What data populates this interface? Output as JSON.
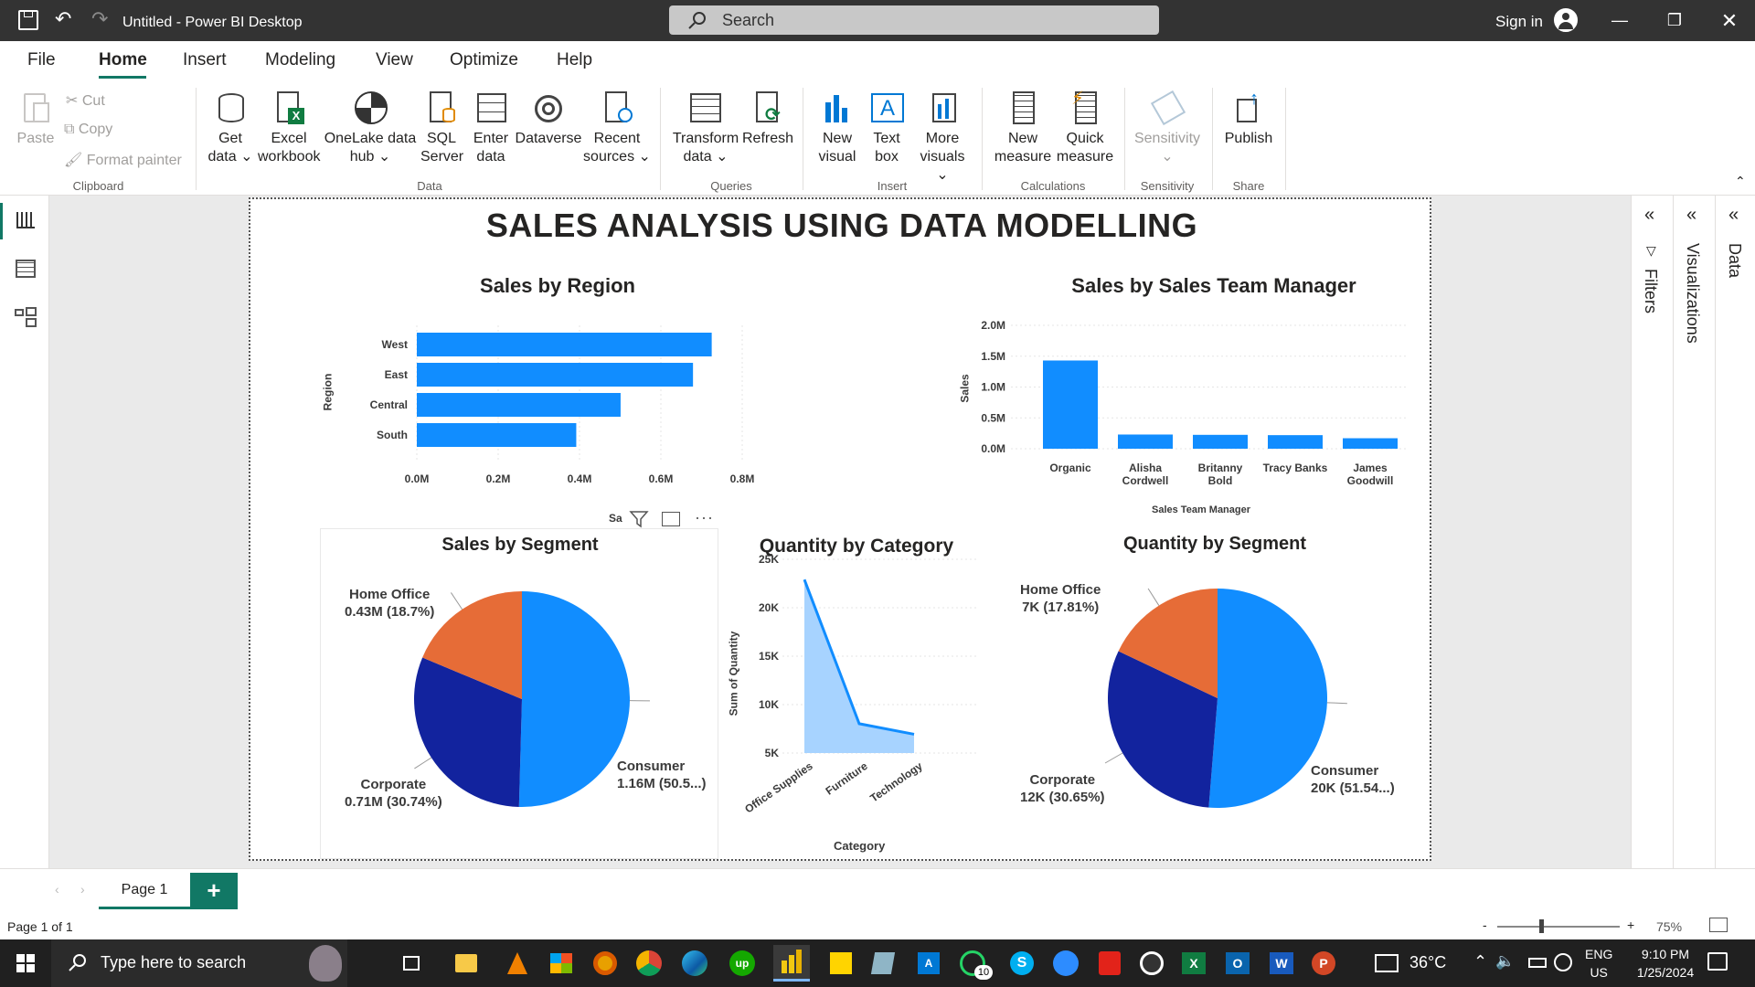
{
  "window": {
    "title": "Untitled - Power BI Desktop",
    "search_placeholder": "Search",
    "sign_in": "Sign in"
  },
  "menu": [
    "File",
    "Home",
    "Insert",
    "Modeling",
    "View",
    "Optimize",
    "Help"
  ],
  "ribbon": {
    "clipboard": {
      "paste": "Paste",
      "cut": "Cut",
      "copy": "Copy",
      "format_painter": "Format painter",
      "group": "Clipboard"
    },
    "data": {
      "get_data": "Get",
      "get_data2": "data",
      "excel": "Excel",
      "excel2": "workbook",
      "onelake": "OneLake data",
      "onelake2": "hub",
      "sql": "SQL",
      "sql2": "Server",
      "enter": "Enter",
      "enter2": "data",
      "dataverse": "Dataverse",
      "recent": "Recent",
      "recent2": "sources",
      "group": "Data"
    },
    "queries": {
      "transform": "Transform",
      "transform2": "data",
      "refresh": "Refresh",
      "group": "Queries"
    },
    "insert": {
      "new_visual": "New",
      "new_visual2": "visual",
      "text_box": "Text",
      "text_box2": "box",
      "more_visuals": "More",
      "more_visuals2": "visuals",
      "group": "Insert"
    },
    "calculations": {
      "new_measure": "New",
      "new_measure2": "measure",
      "quick_measure": "Quick",
      "quick_measure2": "measure",
      "group": "Calculations"
    },
    "sensitivity": {
      "label": "Sensitivity",
      "group": "Sensitivity"
    },
    "share": {
      "publish": "Publish",
      "group": "Share"
    }
  },
  "report_title": "SALES ANALYSIS USING DATA MODELLING",
  "charts": {
    "region": {
      "title": "Sales by Region",
      "ylabel": "Region",
      "xlabel": "Sa",
      "ticks": [
        "0.0M",
        "0.2M",
        "0.4M",
        "0.6M",
        "0.8M"
      ]
    },
    "manager": {
      "title": "Sales by Sales Team Manager",
      "ylabel": "Sales",
      "xlabel": "Sales Team Manager",
      "ticks": [
        "0.0M",
        "0.5M",
        "1.0M",
        "1.5M",
        "2.0M"
      ]
    },
    "segment_sales": {
      "title": "Sales by Segment",
      "labels": [
        {
          "name": "Home Office",
          "value": "0.43M (18.7%)"
        },
        {
          "name": "Corporate",
          "value": "0.71M (30.74%)"
        },
        {
          "name": "Consumer",
          "value": "1.16M (50.5...)"
        }
      ]
    },
    "category": {
      "title": "Quantity by Category",
      "ylabel": "Sum of Quantity",
      "xlabel": "Category",
      "ticks": [
        "5K",
        "10K",
        "15K",
        "20K",
        "25K"
      ]
    },
    "segment_qty": {
      "title": "Quantity by Segment",
      "labels": [
        {
          "name": "Home Office",
          "value": "7K (17.81%)"
        },
        {
          "name": "Corporate",
          "value": "12K (30.65%)"
        },
        {
          "name": "Consumer",
          "value": "20K (51.54...)"
        }
      ]
    }
  },
  "chart_data": [
    {
      "type": "bar",
      "title": "Sales by Region",
      "orientation": "horizontal",
      "categories": [
        "West",
        "East",
        "Central",
        "South"
      ],
      "values": [
        725000,
        679000,
        501000,
        392000
      ],
      "xlim": [
        0,
        800000
      ],
      "ylabel": "Region"
    },
    {
      "type": "bar",
      "title": "Sales by Sales Team Manager",
      "categories": [
        "Organic",
        "Alisha Cordwell",
        "Britanny Bold",
        "Tracy Banks",
        "James Goodwill"
      ],
      "values": [
        1430000,
        230000,
        225000,
        220000,
        170000
      ],
      "ylim": [
        0,
        2000000
      ],
      "xlabel": "Sales Team Manager",
      "ylabel": "Sales"
    },
    {
      "type": "pie",
      "title": "Sales by Segment",
      "categories": [
        "Consumer",
        "Corporate",
        "Home Office"
      ],
      "values": [
        1160000,
        710000,
        430000
      ],
      "percent": [
        50.5,
        30.74,
        18.7
      ],
      "colors": [
        "#118dff",
        "#12239e",
        "#e66c37"
      ]
    },
    {
      "type": "area",
      "title": "Quantity by Category",
      "categories": [
        "Office Supplies",
        "Furniture",
        "Technology"
      ],
      "values": [
        22906,
        8028,
        6939
      ],
      "xlabel": "Category",
      "ylabel": "Sum of Quantity",
      "ylim": [
        5000,
        25000
      ]
    },
    {
      "type": "pie",
      "title": "Quantity by Segment",
      "categories": [
        "Consumer",
        "Corporate",
        "Home Office"
      ],
      "values": [
        20000,
        12000,
        7000
      ],
      "percent": [
        51.54,
        30.65,
        17.81
      ],
      "colors": [
        "#118dff",
        "#12239e",
        "#e66c37"
      ]
    }
  ],
  "right_panes": {
    "filters": "Filters",
    "visualizations": "Visualizations",
    "data": "Data"
  },
  "pages": {
    "tab": "Page 1",
    "add": "+"
  },
  "status": {
    "page": "Page 1 of 1",
    "zoom": "75%"
  },
  "taskbar": {
    "search": "Type here to search",
    "weather": "36°C",
    "lang1": "ENG",
    "lang2": "US",
    "time": "9:10 PM",
    "date": "1/25/2024",
    "whatsapp_badge": "10"
  },
  "colors": {
    "accent": "#118dff",
    "dark": "#12239e",
    "orange": "#e66c37",
    "area_fill": "#a7d3ff",
    "titlebar": "#333333",
    "taskbar": "#202020"
  }
}
